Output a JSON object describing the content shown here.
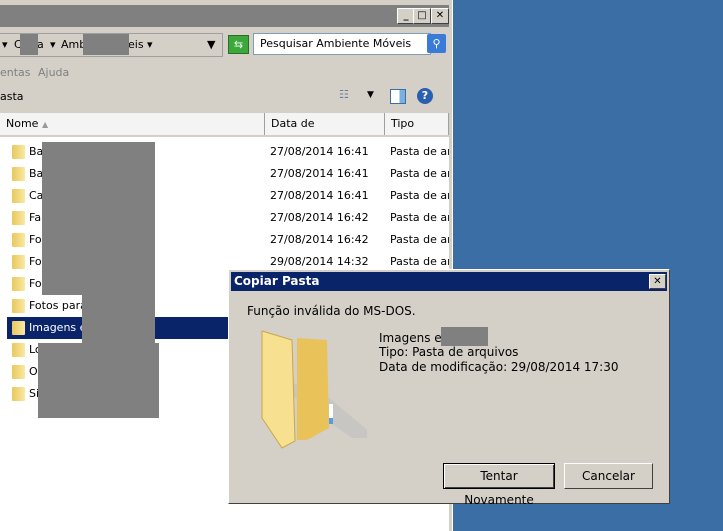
{
  "explorer": {
    "address": [
      "C",
      "a",
      "Ambi",
      "eis"
    ],
    "search_placeholder": "Pesquisar Ambiente Móveis",
    "menu": [
      "entas",
      "Ajuda"
    ],
    "toolbar_label": "asta",
    "columns": [
      "Nome",
      "Data de modificação",
      "Tipo"
    ],
    "rows": [
      {
        "name": "Ba",
        "date": "27/08/2014 16:41",
        "type": "Pasta de arc"
      },
      {
        "name": "Ba",
        "date": "27/08/2014 16:41",
        "type": "Pasta de arc"
      },
      {
        "name": "Ca",
        "date": "27/08/2014 16:41",
        "type": "Pasta de arc"
      },
      {
        "name": "Fa",
        "date": "27/08/2014 16:42",
        "type": "Pasta de arc"
      },
      {
        "name": "Fo",
        "date": "27/08/2014 16:42",
        "type": "Pasta de arc"
      },
      {
        "name": "Fo",
        "date": "29/08/2014 14:32",
        "type": "Pasta de arc"
      },
      {
        "name": "Fo",
        "date": "",
        "type": ""
      },
      {
        "name": "Fotos para",
        "date": "",
        "type": ""
      },
      {
        "name": "Imagens en",
        "date": "",
        "type": ""
      },
      {
        "name": "Lo",
        "date": "",
        "type": ""
      },
      {
        "name": "O",
        "date": "",
        "type": ""
      },
      {
        "name": "Si",
        "date": "",
        "type": ""
      }
    ]
  },
  "dialog": {
    "title": "Copiar Pasta",
    "message": "Função inválida do MS-DOS.",
    "item_name": "Imagens en",
    "item_type": "Tipo: Pasta de arquivos",
    "item_date": "Data de modificação: 29/08/2014 17:30",
    "retry": "Tentar Novamente",
    "cancel": "Cancelar"
  }
}
